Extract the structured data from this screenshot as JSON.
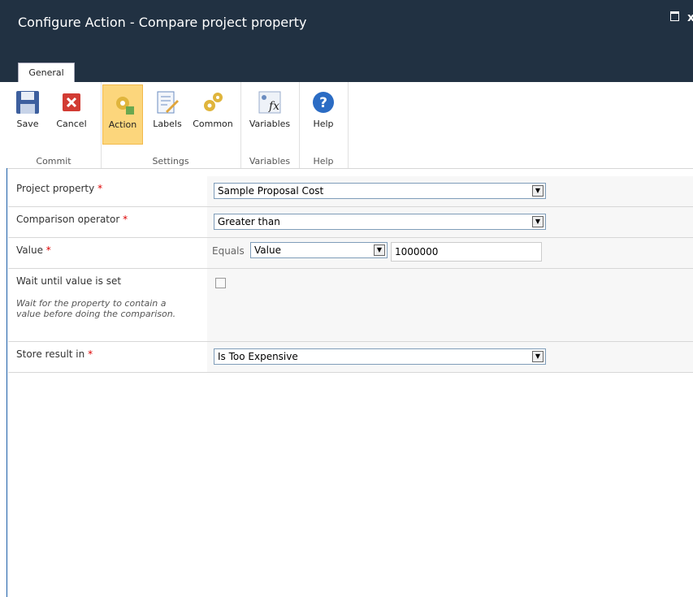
{
  "window": {
    "title": "Configure Action - Compare project property",
    "maximize_label": "",
    "close_label": "x"
  },
  "tabs": [
    {
      "label": "General",
      "active": true
    }
  ],
  "ribbon": {
    "groups": {
      "commit": {
        "label": "Commit",
        "buttons": [
          {
            "label": "Save",
            "icon": "save-icon"
          },
          {
            "label": "Cancel",
            "icon": "cancel-icon"
          }
        ]
      },
      "settings": {
        "label": "Settings",
        "buttons": [
          {
            "label": "Action",
            "icon": "action-gear-icon",
            "active": true
          },
          {
            "label": "Labels",
            "icon": "labels-icon"
          },
          {
            "label": "Common",
            "icon": "common-gear-icon"
          }
        ]
      },
      "variables": {
        "label": "Variables",
        "buttons": [
          {
            "label": "Variables",
            "icon": "variables-fx-icon"
          }
        ]
      },
      "help": {
        "label": "Help",
        "buttons": [
          {
            "label": "Help",
            "icon": "help-icon"
          }
        ]
      }
    }
  },
  "form": {
    "project_property": {
      "label": "Project property",
      "required": "*",
      "value": "Sample Proposal Cost"
    },
    "comparison_operator": {
      "label": "Comparison operator",
      "required": "*",
      "value": "Greater than"
    },
    "value": {
      "label": "Value",
      "required": "*",
      "prefix": "Equals",
      "type_value": "Value",
      "input_value": "1000000"
    },
    "wait_until_set": {
      "label": "Wait until value is set",
      "checked": false,
      "help": "Wait for the property to contain a value before doing the comparison."
    },
    "store_result_in": {
      "label": "Store result in",
      "required": "*",
      "value": "Is Too Expensive"
    }
  },
  "colors": {
    "title_bar": "#213142",
    "active_button_bg": "#fcd67c",
    "required_mark": "#dd0000"
  }
}
